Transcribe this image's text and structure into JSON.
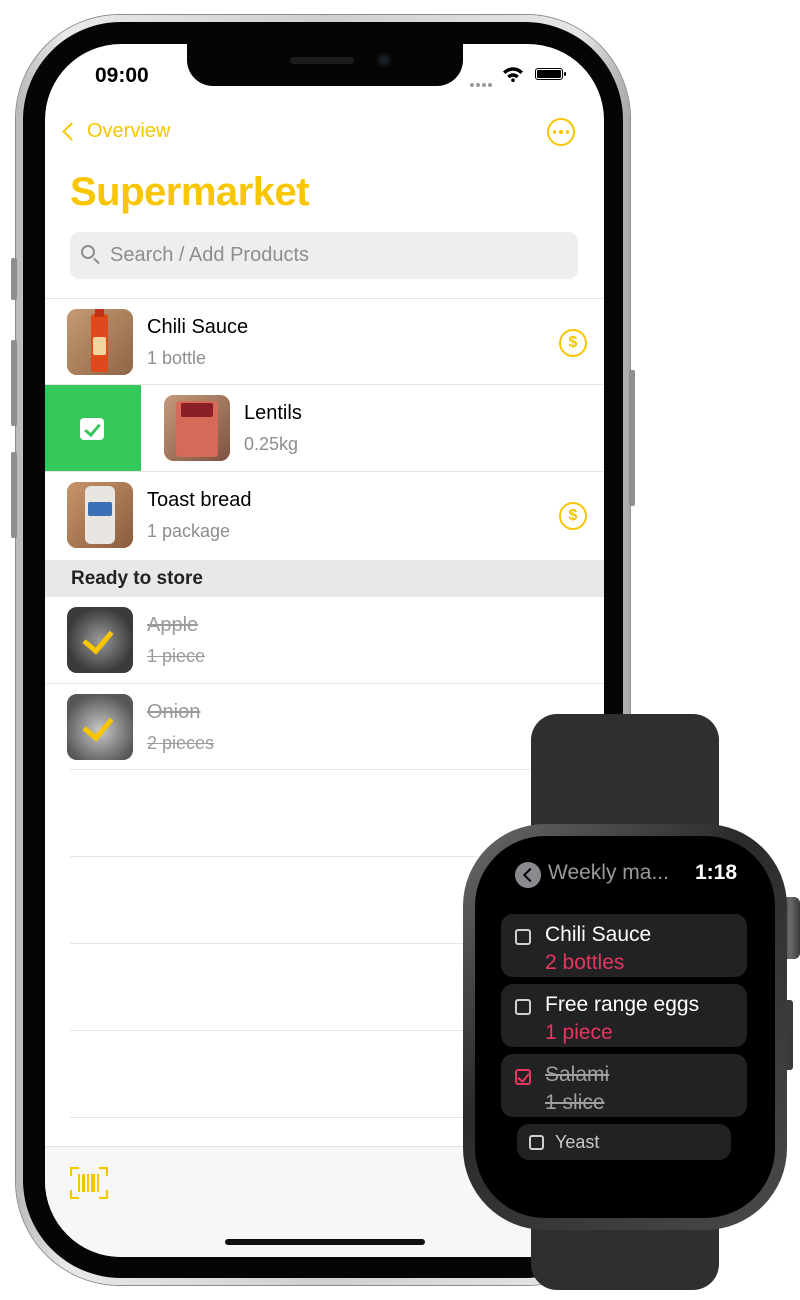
{
  "phone": {
    "status": {
      "time": "09:00"
    },
    "nav": {
      "back_label": "Overview",
      "more_icon": "ellipsis-circle-icon"
    },
    "title": "Supermarket",
    "search": {
      "placeholder": "Search / Add Products"
    },
    "items": [
      {
        "name": "Chili Sauce",
        "qty": "1 bottle",
        "price_icon": "dollar-coin-icon"
      },
      {
        "name": "Lentils",
        "qty": "0.25kg",
        "swipe_action": "check"
      },
      {
        "name": "Toast bread",
        "qty": "1 package",
        "price_icon": "dollar-coin-icon"
      }
    ],
    "section_title": "Ready to store",
    "done_items": [
      {
        "name": "Apple",
        "qty": "1 piece"
      },
      {
        "name": "Onion",
        "qty": "2 pieces"
      }
    ],
    "toolbar": {
      "scan_icon": "barcode-scan-icon"
    },
    "colors": {
      "accent": "#f7c600",
      "swipe_green": "#34c759",
      "secondary_text": "#8d8d92"
    }
  },
  "watch": {
    "title": "Weekly ma...",
    "time": "1:18",
    "items": [
      {
        "name": "Chili Sauce",
        "qty": "2 bottles",
        "checked": false
      },
      {
        "name": "Free range eggs",
        "qty": "1 piece",
        "checked": false
      },
      {
        "name": "Salami",
        "qty": "1 slice",
        "checked": true
      },
      {
        "name": "Yeast",
        "checked": false
      }
    ],
    "colors": {
      "accent": "#e8355e"
    }
  }
}
